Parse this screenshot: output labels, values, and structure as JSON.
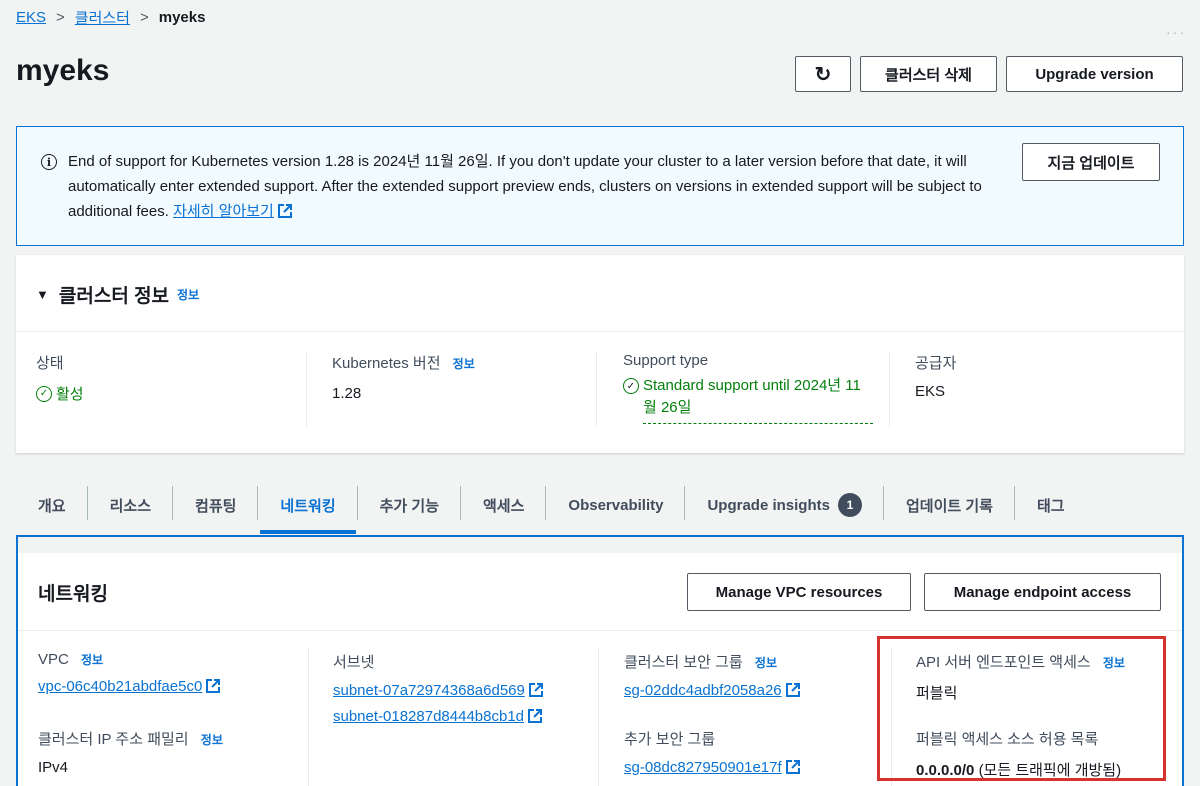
{
  "breadcrumb": {
    "item1": "EKS",
    "item2": "클러스터",
    "current": "myeks",
    "sep": ">"
  },
  "page": {
    "title": "myeks"
  },
  "header_buttons": {
    "refresh_icon": "↻",
    "delete": "클러스터 삭제",
    "upgrade": "Upgrade version"
  },
  "alert": {
    "icon": "i",
    "text": "End of support for Kubernetes version 1.28 is 2024년 11월 26일. If you don't update your cluster to a later version before that date, it will automatically enter extended support. After the extended support preview ends, clusters on versions in extended support will be subject to additional fees.",
    "learn_more": "자세히 알아보기",
    "update_now": "지금 업데이트"
  },
  "cluster_info": {
    "caret": "▼",
    "title": "클러스터 정보",
    "info": "정보",
    "status_label": "상태",
    "status_value": "활성",
    "k8s_label": "Kubernetes 버전",
    "k8s_info": "정보",
    "k8s_value": "1.28",
    "support_label": "Support type",
    "support_value": "Standard support until 2024년 11월 26일",
    "provider_label": "공급자",
    "provider_value": "EKS"
  },
  "tabs": {
    "overview": "개요",
    "resources": "리소스",
    "compute": "컴퓨팅",
    "networking": "네트워킹",
    "addons": "추가 기능",
    "access": "액세스",
    "observability": "Observability",
    "upgrade_insights": "Upgrade insights",
    "upgrade_insights_badge": "1",
    "update_history": "업데이트 기록",
    "tags": "태그"
  },
  "networking": {
    "title": "네트워킹",
    "manage_vpc": "Manage VPC resources",
    "manage_endpoint": "Manage endpoint access",
    "vpc_label": "VPC",
    "vpc_info": "정보",
    "vpc_value": "vpc-06c40b21abdfae5c0",
    "ip_family_label": "클러스터 IP 주소 패밀리",
    "ip_family_info": "정보",
    "ip_family_value": "IPv4",
    "subnets_label": "서브넷",
    "subnets": [
      "subnet-07a72974368a6d569",
      "subnet-018287d8444b8cb1d"
    ],
    "cluster_sg_label": "클러스터 보안 그룹",
    "cluster_sg_info": "정보",
    "cluster_sg_value": "sg-02ddc4adbf2058a26",
    "additional_sg_label": "추가 보안 그룹",
    "additional_sg_value": "sg-08dc827950901e17f",
    "endpoint_label": "API 서버 엔드포인트 액세스",
    "endpoint_info": "정보",
    "endpoint_value": "퍼블릭",
    "allowlist_label": "퍼블릭 액세스 소스 허용 목록",
    "allowlist_cidr": "0.0.0.0/0",
    "allowlist_note": "(모든 트래픽에 개방됨)"
  },
  "colors": {
    "link": "#0972d3",
    "success": "#037f0c",
    "highlight": "#d6322e"
  }
}
